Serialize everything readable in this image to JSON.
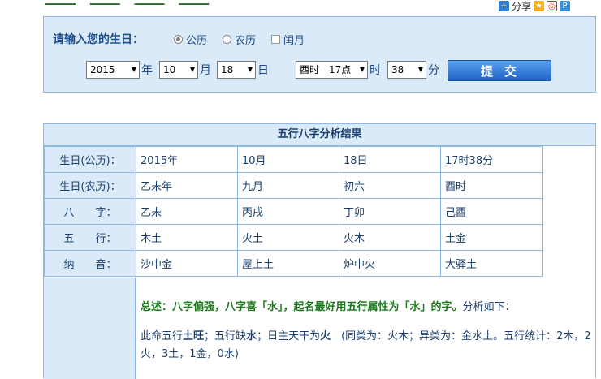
{
  "share": {
    "label": "分享"
  },
  "form": {
    "prompt": "请输入您的生日：",
    "radio_gregorian": "公历",
    "radio_lunar": "农历",
    "checkbox_leap": "闰月",
    "year": "2015",
    "year_unit": "年",
    "month": "10",
    "month_unit": "月",
    "day": "18",
    "day_unit": "日",
    "hour": "酉时　17点",
    "hour_unit": "时",
    "minute": "38",
    "minute_unit": "分",
    "submit": "提交"
  },
  "result": {
    "title": "五行八字分析结果",
    "rows": [
      {
        "label": "生日(公历)：",
        "cells": [
          "2015年",
          "10月",
          "18日",
          "17时38分"
        ]
      },
      {
        "label": "生日(农历)：",
        "cells": [
          "乙未年",
          "九月",
          "初六",
          "酉时"
        ]
      },
      {
        "label": "八　　字：",
        "cells": [
          "乙未",
          "丙戌",
          "丁卯",
          "己酉"
        ]
      },
      {
        "label": "五　　行：",
        "cells": [
          "木土",
          "火土",
          "火木",
          "土金"
        ]
      },
      {
        "label": "纳　　音：",
        "cells": [
          "沙中金",
          "屋上土",
          "炉中火",
          "大驿土"
        ]
      }
    ],
    "summary_bold": "总述：八字偏强，八字喜「水」，起名最好用五行属性为「水」的字。",
    "summary_tail": "分析如下：",
    "analysis_1": "此命五行",
    "analysis_2": "土旺",
    "analysis_3": "；五行缺",
    "analysis_4": "水",
    "analysis_5": "；日主天干为",
    "analysis_6": "火",
    "analysis_7": "　(同类为：火木；异类为：金水土。五行统计：2木，2火，3土，1金，0水)"
  }
}
